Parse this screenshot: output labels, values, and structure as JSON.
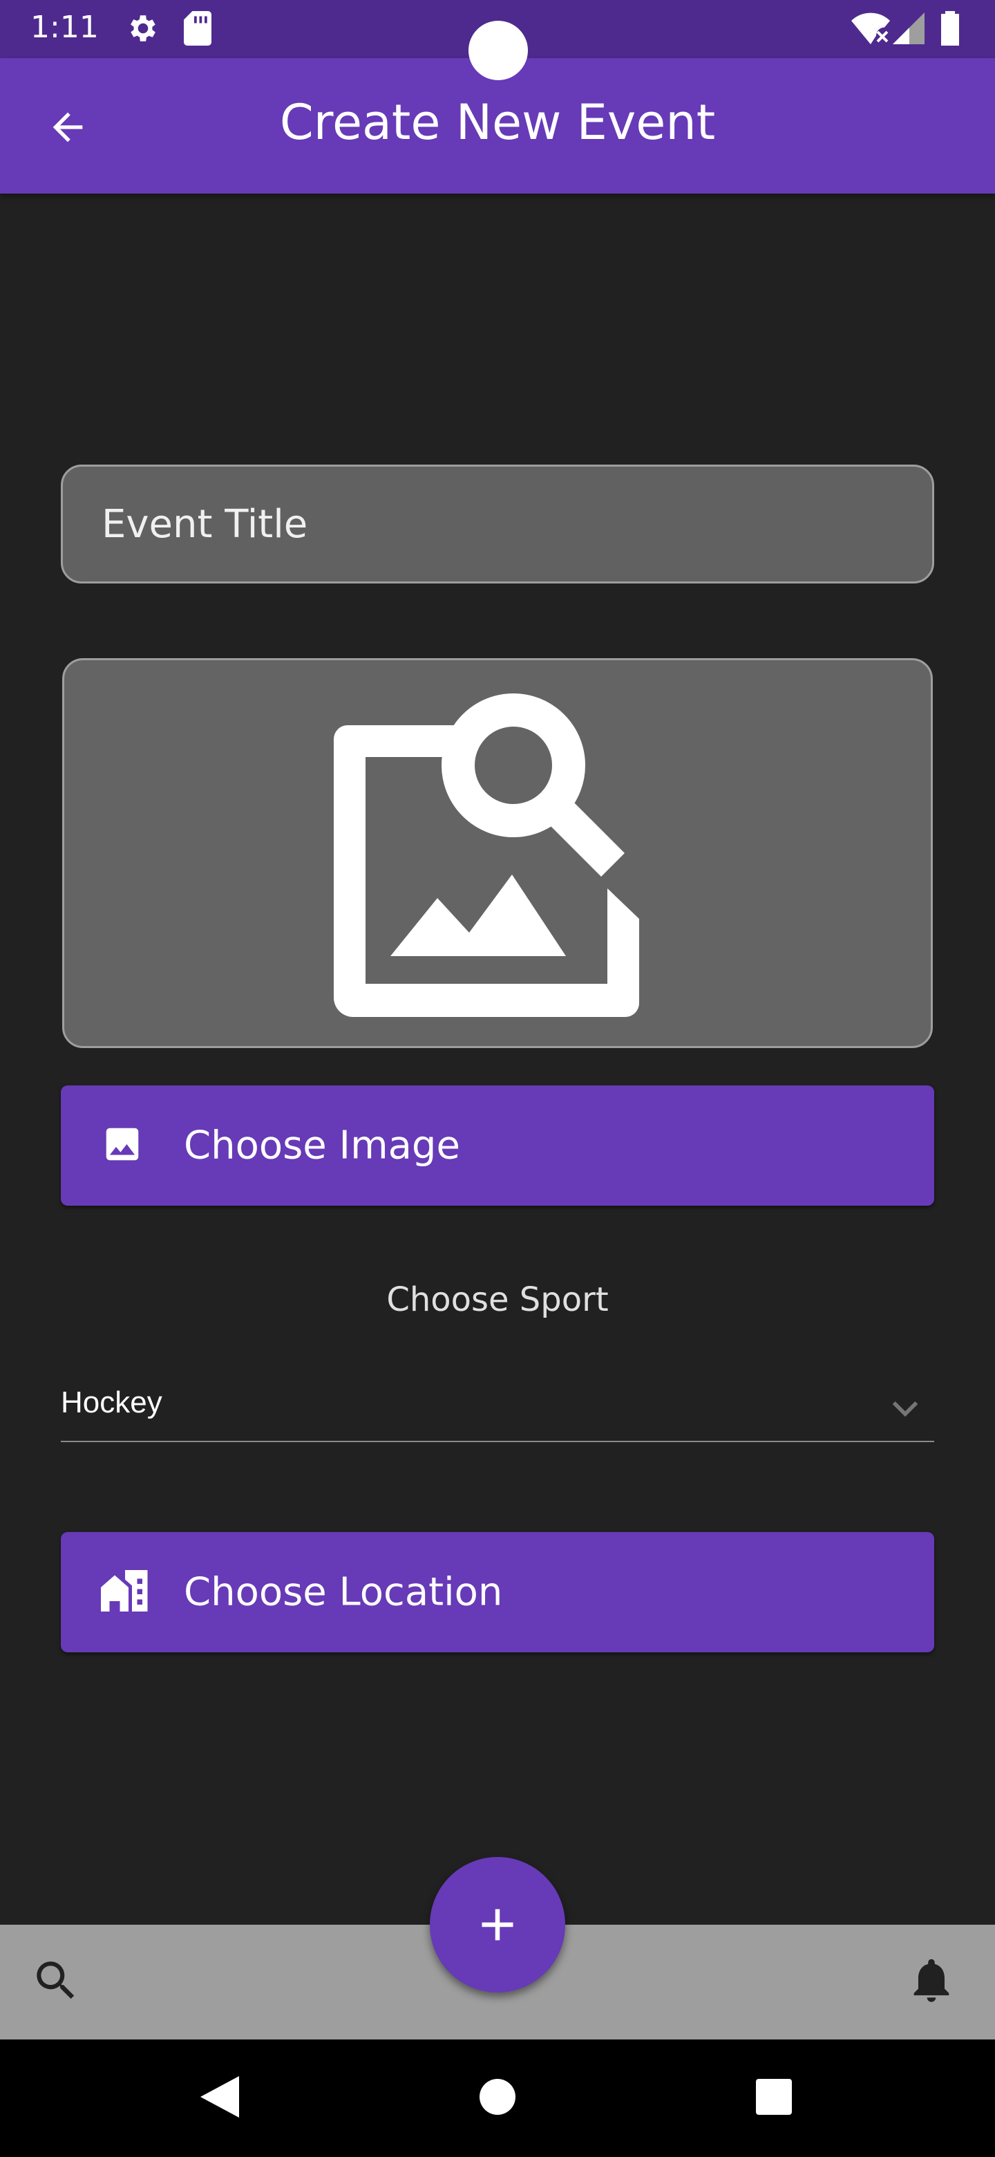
{
  "status_bar": {
    "time": "1:11",
    "icons": [
      "settings-icon",
      "sd-card-icon",
      "wifi-off-icon",
      "signal-icon",
      "battery-icon"
    ]
  },
  "app_bar": {
    "title": "Create New Event",
    "back_icon": "arrow-back-icon"
  },
  "form": {
    "title_field": {
      "placeholder": "Event Title",
      "value": ""
    },
    "image_preview_icon": "image-search-icon",
    "choose_image_button": {
      "label": "Choose Image",
      "icon": "image-icon"
    },
    "sport_section": {
      "label": "Choose Sport",
      "selected": "Hockey"
    },
    "choose_location_button": {
      "label": "Choose Location",
      "icon": "location-city-icon"
    }
  },
  "bottom_bar": {
    "left_icon": "search-icon",
    "right_icon": "bell-icon",
    "fab_icon": "plus-icon"
  },
  "nav_bar": {
    "buttons": [
      "back-triangle-icon",
      "home-circle-icon",
      "recents-square-icon"
    ]
  },
  "colors": {
    "primary": "#673ab7",
    "status_bar": "#4e2a8e",
    "background": "#212121",
    "field_fill": "#616161",
    "bottom_bar": "#9e9e9e"
  }
}
